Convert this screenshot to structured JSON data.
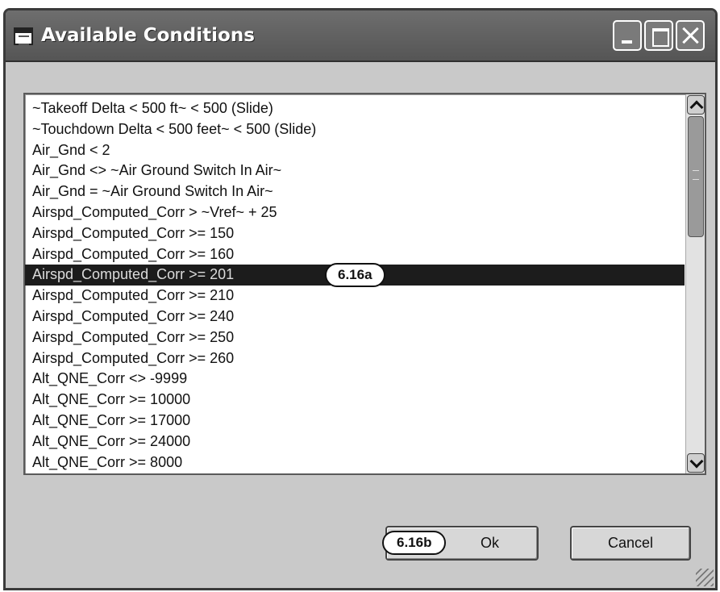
{
  "window": {
    "title": "Available Conditions"
  },
  "list": {
    "items": [
      "~Takeoff Delta < 500 ft~ < 500 (Slide)",
      "~Touchdown Delta < 500 feet~ < 500 (Slide)",
      "Air_Gnd < 2",
      "Air_Gnd <> ~Air Ground Switch In Air~",
      "Air_Gnd = ~Air Ground Switch In Air~",
      "Airspd_Computed_Corr > ~Vref~ + 25",
      "Airspd_Computed_Corr >= 150",
      "Airspd_Computed_Corr >= 160",
      "Airspd_Computed_Corr >= 201",
      "Airspd_Computed_Corr >= 210",
      "Airspd_Computed_Corr >= 240",
      "Airspd_Computed_Corr >= 250",
      "Airspd_Computed_Corr >= 260",
      "Alt_QNE_Corr <> -9999",
      "Alt_QNE_Corr >= 10000",
      "Alt_QNE_Corr >= 17000",
      "Alt_QNE_Corr >= 24000",
      "Alt_QNE_Corr >= 8000"
    ],
    "selected_index": 8,
    "selected_callout": "6.16a"
  },
  "buttons": {
    "ok_label": "Ok",
    "ok_callout": "6.16b",
    "cancel_label": "Cancel"
  },
  "icons": {
    "app": "window-app-icon",
    "minimize": "minimize-icon",
    "maximize": "maximize-icon",
    "close": "close-icon",
    "scroll_up": "chevron-up-icon",
    "scroll_down": "chevron-down-icon",
    "resize": "resize-grip-icon"
  }
}
